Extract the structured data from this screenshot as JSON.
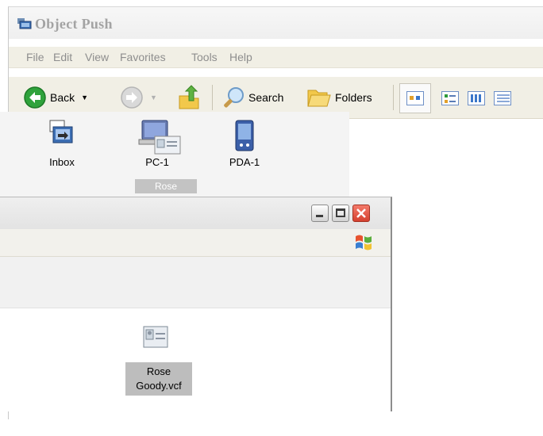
{
  "window": {
    "title": "Object Push"
  },
  "menu": [
    "File",
    "Edit",
    "View",
    "Favorites",
    "Tools",
    "Help"
  ],
  "toolbar": {
    "back_label": "Back",
    "search_label": "Search",
    "folders_label": "Folders"
  },
  "icons": [
    {
      "label": "Inbox",
      "icon": "inbox-icon"
    },
    {
      "label": "PC-1",
      "icon": "computer-icon"
    },
    {
      "label": "PDA-1",
      "icon": "pda-icon"
    }
  ],
  "drag_ghost_label": "Rose",
  "second_window": {
    "file_name": "Rose\nGoody.vcf",
    "file_name_line1": "Rose",
    "file_name_line2": "Goody.vcf"
  },
  "colors": {
    "toolbar_bg": "#f1efe5",
    "close_button": "#d5412f",
    "selection_bg": "#bdbdbd"
  }
}
